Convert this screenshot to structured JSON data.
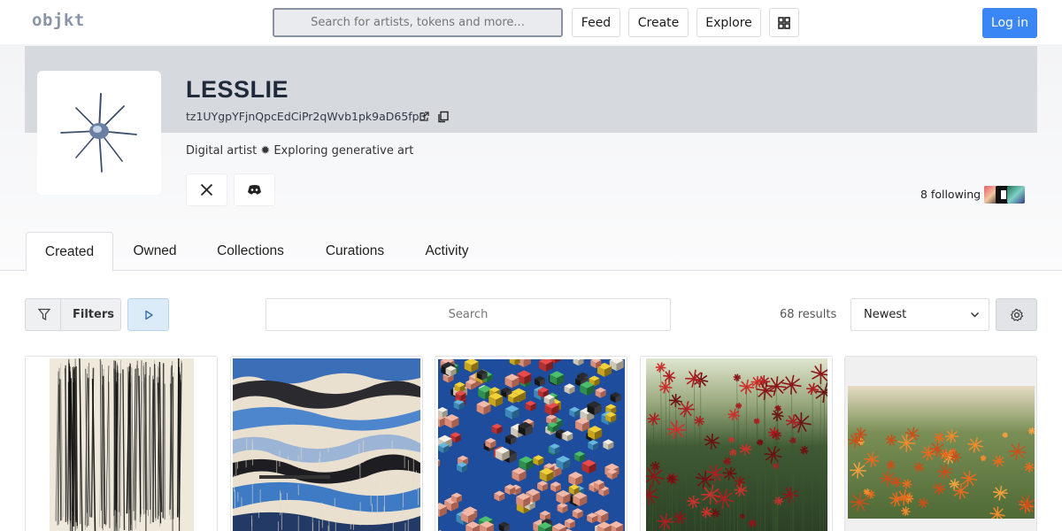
{
  "nav": {
    "logo": "objkt",
    "search_placeholder": "Search for artists, tokens and more...",
    "feed": "Feed",
    "create": "Create",
    "explore": "Explore",
    "login": "Log in",
    "accent_color": "#3a86f5"
  },
  "profile": {
    "name": "LESSLIE",
    "address": "tz1UYgpYFjnQpcEdCiPr2qWvb1pk9aD65fp3",
    "bio": "Digital artist ✹ Exploring generative art",
    "following": "8 following",
    "social": [
      {
        "icon": "x-twitter-icon"
      },
      {
        "icon": "discord-icon"
      }
    ]
  },
  "tabs": [
    "Created",
    "Owned",
    "Collections",
    "Curations",
    "Activity"
  ],
  "active_tab": "Created",
  "toolbar": {
    "filters_label": "Filters",
    "search_placeholder": "Search",
    "results": "68 results",
    "sort_value": "Newest"
  },
  "tokens": [
    {
      "style": "black vertical line noise"
    },
    {
      "style": "blue and beige layered landscape"
    },
    {
      "style": "isometric colorful cubes on blue"
    },
    {
      "style": "red flowers on green field"
    },
    {
      "style": "orange flowers field"
    }
  ]
}
